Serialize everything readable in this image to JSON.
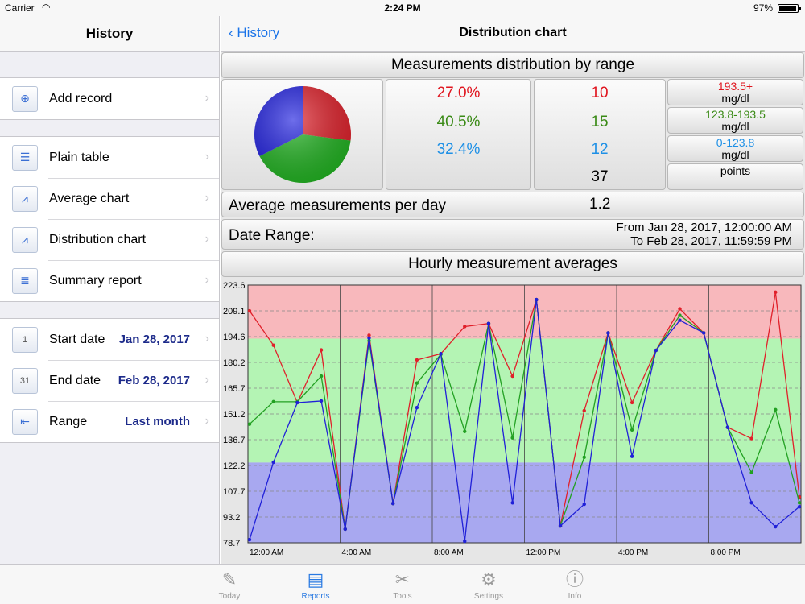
{
  "status": {
    "carrier": "Carrier",
    "time": "2:24 PM",
    "battery": "97%"
  },
  "sidebar": {
    "title": "History",
    "add": {
      "label": "Add record"
    },
    "reports": [
      {
        "label": "Plain table"
      },
      {
        "label": "Average chart"
      },
      {
        "label": "Distribution chart"
      },
      {
        "label": "Summary report"
      }
    ],
    "filters": [
      {
        "label": "Start date",
        "value": "Jan 28, 2017",
        "icon": "1"
      },
      {
        "label": "End date",
        "value": "Feb 28, 2017",
        "icon": "31"
      },
      {
        "label": "Range",
        "value": "Last month"
      }
    ]
  },
  "nav": {
    "back": "History",
    "title": "Distribution chart"
  },
  "distribution": {
    "title": "Measurements distribution by range",
    "rows": [
      {
        "percent": "27.0%",
        "count": "10",
        "range": "193.5+",
        "unit": "mg/dl",
        "color": "#e0141e"
      },
      {
        "percent": "40.5%",
        "count": "15",
        "range": "123.8-193.5",
        "unit": "mg/dl",
        "color": "#3a8a16"
      },
      {
        "percent": "32.4%",
        "count": "12",
        "range": "0-123.8",
        "unit": "mg/dl",
        "color": "#1e90e6"
      }
    ],
    "total": "37",
    "total_label": "points",
    "pie": [
      {
        "value": 27.0,
        "color": "#e0202a"
      },
      {
        "value": 40.5,
        "color": "#22b422"
      },
      {
        "value": 32.4,
        "color": "#2020e0"
      }
    ]
  },
  "avg_per_day": {
    "label": "Average measurements per day",
    "value": "1.2"
  },
  "date_range": {
    "label": "Date Range:",
    "from": "From Jan 28, 2017, 12:00:00 AM",
    "to": "To Feb 28, 2017, 11:59:59 PM"
  },
  "chart_data": {
    "type": "line",
    "title": "Hourly measurement averages",
    "ylim": [
      78.7,
      223.6
    ],
    "y_ticks": [
      "223.6",
      "209.1",
      "194.6",
      "180.2",
      "165.7",
      "151.2",
      "136.7",
      "122.2",
      "107.7",
      "93.2",
      "78.7"
    ],
    "x_tick_labels": [
      "12:00 AM",
      "4:00 AM",
      "8:00 AM",
      "12:00 PM",
      "4:00 PM",
      "8:00 PM"
    ],
    "xlim": [
      0,
      24
    ],
    "bands": [
      {
        "from": 193.5,
        "to": 223.6,
        "color": "#f8b8bc"
      },
      {
        "from": 123.8,
        "to": 193.5,
        "color": "#b4f4b4"
      },
      {
        "from": 78.7,
        "to": 123.8,
        "color": "#a8a8f0"
      }
    ],
    "x": [
      0,
      1,
      2,
      3,
      4,
      5,
      6,
      7,
      8,
      9,
      10,
      11,
      12,
      13,
      14,
      15,
      16,
      17,
      18,
      19,
      20,
      21,
      22,
      23
    ],
    "series": [
      {
        "color": "#e0202a",
        "values": [
          209.1,
          189.8,
          157.5,
          187.1,
          86.4,
          195.4,
          100.8,
          181.5,
          185.0,
          200.3,
          202.0,
          172.4,
          215.4,
          88.2,
          153.0,
          196.7,
          157.5,
          186.9,
          210.2,
          196.7,
          143.6,
          137.3,
          219.6,
          104.5
        ]
      },
      {
        "color": "#22a022",
        "values": [
          145.4,
          158.0,
          158.0,
          172.4,
          86.4,
          192.3,
          100.8,
          168.5,
          184.6,
          141.3,
          202.0,
          137.7,
          215.4,
          88.2,
          126.8,
          196.7,
          142.2,
          186.9,
          206.6,
          196.7,
          143.6,
          118.2,
          153.5,
          101.2
        ]
      },
      {
        "color": "#2020d8",
        "values": [
          80.5,
          124.0,
          157.5,
          158.4,
          86.4,
          193.8,
          100.8,
          154.7,
          185.0,
          79.6,
          202.0,
          101.2,
          215.4,
          88.2,
          100.4,
          196.7,
          127.3,
          186.9,
          203.8,
          196.7,
          143.6,
          101.2,
          87.7,
          99.0
        ]
      }
    ]
  },
  "tabs": [
    {
      "label": "Today",
      "icon": "✎"
    },
    {
      "label": "Reports",
      "icon": "▤"
    },
    {
      "label": "Tools",
      "icon": "✂"
    },
    {
      "label": "Settings",
      "icon": "⚙"
    },
    {
      "label": "Info",
      "icon": "ⓘ"
    }
  ]
}
